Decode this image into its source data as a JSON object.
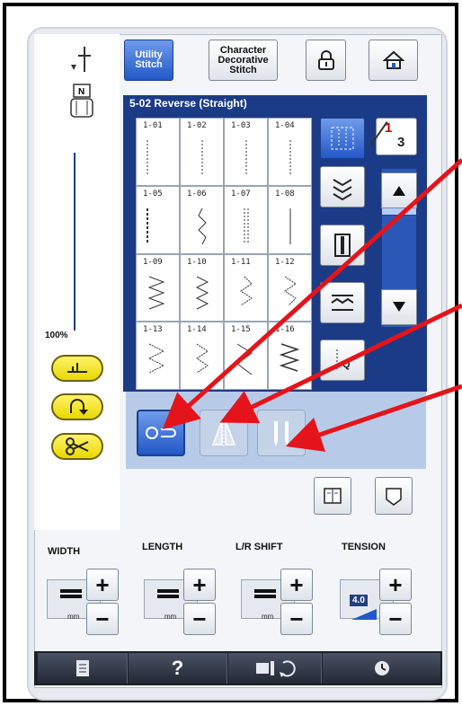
{
  "tabs": {
    "utility": "Utility Stitch",
    "character": "Character Decorative Stitch"
  },
  "stitch_title": "5-02  Reverse (Straight)",
  "zoom": "100%",
  "stitches": [
    "1-01",
    "1-02",
    "1-03",
    "1-04",
    "1-05",
    "1-06",
    "1-07",
    "1-08",
    "1-09",
    "1-10",
    "1-11",
    "1-12",
    "1-13",
    "1-14",
    "1-15",
    "1-16"
  ],
  "page": {
    "current": "1",
    "total": "3"
  },
  "settings": {
    "width": "WIDTH",
    "length": "LENGTH",
    "lr_shift": "L/R SHIFT",
    "tension": "TENSION",
    "unit": "mm",
    "tension_value": "4.0"
  },
  "bottom": {
    "help": "?"
  },
  "colors": {
    "panel": "#1c3b86",
    "strip": "#b7cbe9",
    "accent": "#2258c8",
    "arrow": "#e4141a"
  }
}
